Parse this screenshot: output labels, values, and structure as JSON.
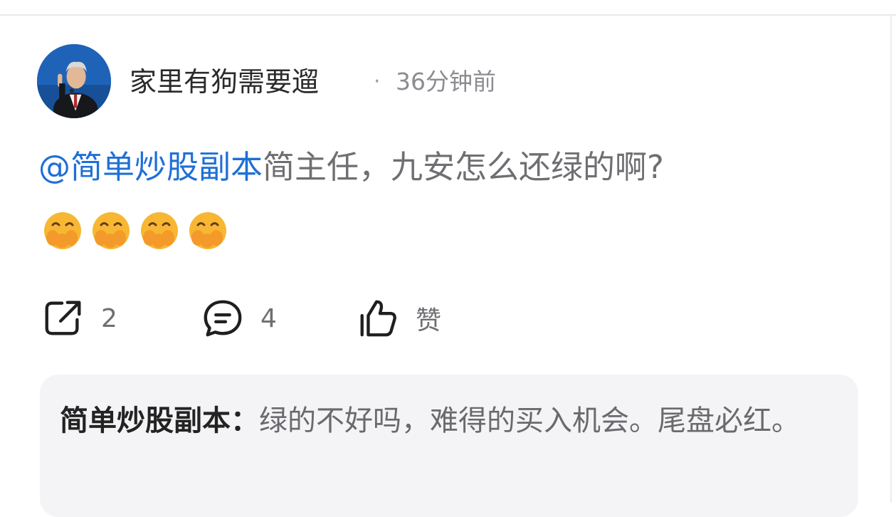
{
  "post": {
    "author": "家里有狗需要遛",
    "separator": "·",
    "time": "36分钟前",
    "mention": "@简单炒股副本",
    "text": "简主任，九安怎么还绿的啊?",
    "emoji": [
      "grin-covering-face-emoji",
      "grin-covering-face-emoji",
      "grin-covering-face-emoji",
      "grin-covering-face-emoji"
    ]
  },
  "actions": {
    "share_count": "2",
    "comment_count": "4",
    "like_label": "赞"
  },
  "reply": {
    "author": "简单炒股副本：",
    "text": "绿的不好吗，难得的买入机会。尾盘必红。"
  },
  "colors": {
    "mention": "#1f6fd6",
    "text": "#6f6f73",
    "reply_bg": "#f4f4f6"
  }
}
